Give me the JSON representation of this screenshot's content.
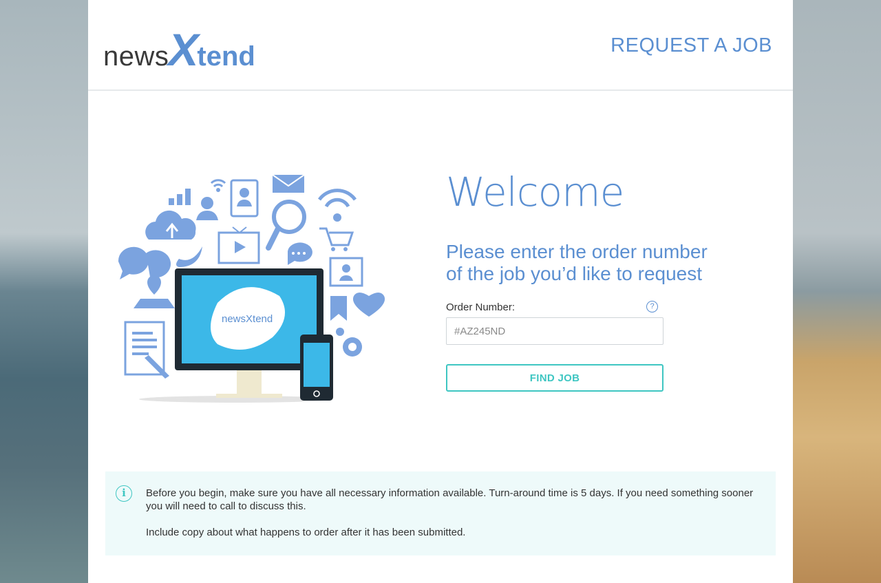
{
  "header": {
    "logo": {
      "part1": "news",
      "part2": "X",
      "part3": "tend"
    },
    "page_title": "REQUEST A JOB"
  },
  "illustration": {
    "screen_logo": "newsXtend"
  },
  "hero": {
    "welcome": "Welcome",
    "subheading_line1": "Please enter the order number",
    "subheading_line2": "of the job you’d like to request"
  },
  "form": {
    "order_label": "Order Number:",
    "help_symbol": "?",
    "order_placeholder": "#AZ245ND",
    "order_value": "",
    "find_button": "FIND JOB"
  },
  "notice": {
    "icon_symbol": "i",
    "paragraph1": "Before you begin, make sure you have all necessary information available.  Turn-around time is 5 days. If you need something sooner you will need to call to discuss this.",
    "paragraph2": "Include copy about what happens to order after it has been submitted."
  },
  "colors": {
    "brand_blue": "#5b8fd1",
    "accent_teal": "#3ec6c2",
    "notice_bg": "#eefafa"
  }
}
